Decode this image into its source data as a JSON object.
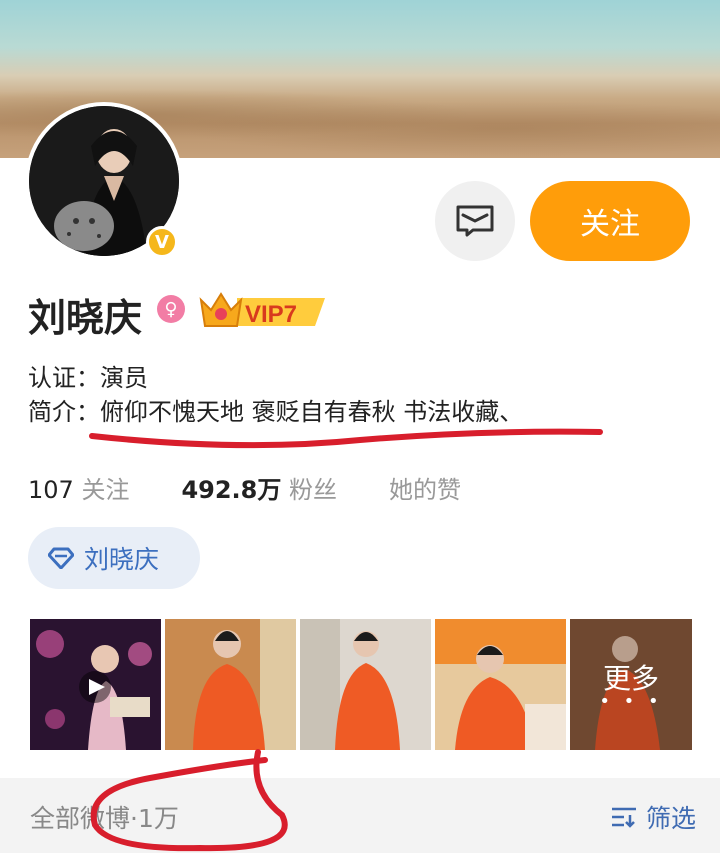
{
  "profile": {
    "name": "刘晓庆",
    "vip_label": "VIP7",
    "verified_badge": "V",
    "gender_symbol": "♀",
    "certification": "认证：演员",
    "intro": "简介：俯仰不愧天地  褒贬自有春秋  书法收藏、"
  },
  "actions": {
    "follow_label": "关注",
    "message_icon": "message-icon"
  },
  "stats": {
    "following_count": "107",
    "following_label": "关注",
    "fans_count": "492.8万",
    "fans_label": "粉丝",
    "likes_label": "她的赞"
  },
  "super_topic": {
    "label": "刘晓庆",
    "icon": "diamond-icon"
  },
  "photos": {
    "more_label": "更多",
    "more_dots": "• • •"
  },
  "feed": {
    "all_label": "全部微博·1万",
    "filter_label": "筛选"
  },
  "colors": {
    "follow": "#ff9d0a",
    "link": "#3f6bb2",
    "annotation": "#d81e2c"
  }
}
